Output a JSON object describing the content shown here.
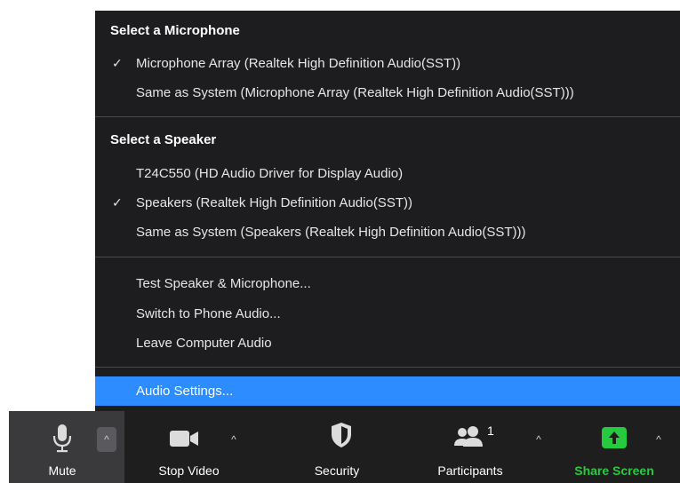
{
  "audio_menu": {
    "microphone_section": {
      "header": "Select a Microphone",
      "items": [
        {
          "label": "Microphone Array (Realtek High Definition Audio(SST))",
          "checked": true
        },
        {
          "label": "Same as System (Microphone Array (Realtek High Definition Audio(SST)))",
          "checked": false
        }
      ]
    },
    "speaker_section": {
      "header": "Select a Speaker",
      "items": [
        {
          "label": "T24C550 (HD Audio Driver for Display Audio)",
          "checked": false
        },
        {
          "label": "Speakers (Realtek High Definition Audio(SST))",
          "checked": true
        },
        {
          "label": "Same as System (Speakers (Realtek High Definition Audio(SST)))",
          "checked": false
        }
      ]
    },
    "actions": [
      {
        "label": "Test Speaker & Microphone..."
      },
      {
        "label": "Switch to Phone Audio..."
      },
      {
        "label": "Leave Computer Audio"
      }
    ],
    "settings": {
      "label": "Audio Settings..."
    },
    "check_glyph": "✓"
  },
  "toolbar": {
    "mute": {
      "label": "Mute",
      "icon": "microphone-icon"
    },
    "stop_video": {
      "label": "Stop Video",
      "icon": "video-camera-icon"
    },
    "security": {
      "label": "Security",
      "icon": "shield-icon"
    },
    "participants": {
      "label": "Participants",
      "icon": "participants-icon",
      "count": "1"
    },
    "share_screen": {
      "label": "Share Screen",
      "icon": "share-screen-icon"
    },
    "caret": "^"
  },
  "colors": {
    "menu_bg": "#1d1d1f",
    "highlight": "#2d8cff",
    "toolbar_bg": "#1e1e1e",
    "share_green": "#27c93f"
  }
}
